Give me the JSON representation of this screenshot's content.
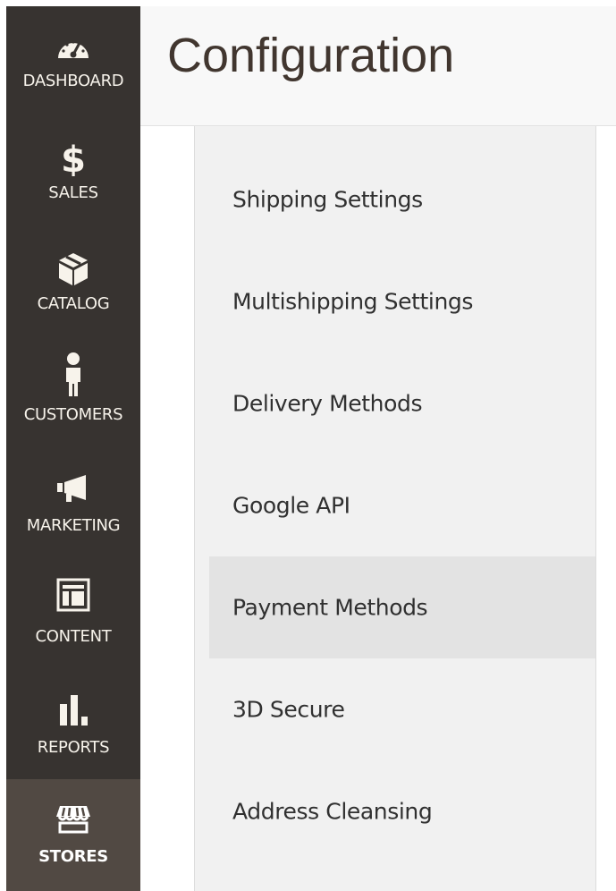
{
  "page": {
    "title": "Configuration"
  },
  "sidebar": {
    "items": [
      {
        "label": "DASHBOARD",
        "icon": "dashboard-gauge-icon"
      },
      {
        "label": "SALES",
        "icon": "dollar-icon"
      },
      {
        "label": "CATALOG",
        "icon": "box-icon"
      },
      {
        "label": "CUSTOMERS",
        "icon": "person-icon"
      },
      {
        "label": "MARKETING",
        "icon": "megaphone-icon"
      },
      {
        "label": "CONTENT",
        "icon": "layout-icon"
      },
      {
        "label": "REPORTS",
        "icon": "bar-chart-icon"
      },
      {
        "label": "STORES",
        "icon": "storefront-icon",
        "active": true
      }
    ]
  },
  "config_menu": {
    "items": [
      {
        "label": "Shipping Settings"
      },
      {
        "label": "Multishipping Settings"
      },
      {
        "label": "Delivery Methods"
      },
      {
        "label": "Google API"
      },
      {
        "label": "Payment Methods",
        "selected": true
      },
      {
        "label": "3D Secure"
      },
      {
        "label": "Address Cleansing"
      }
    ]
  },
  "colors": {
    "sidebar_bg": "#373330",
    "sidebar_active_bg": "#514943",
    "header_bg": "#f8f8f8",
    "panel_bg": "#f1f1f1",
    "selected_item_bg": "#e3e3e3",
    "text_dark": "#303030"
  }
}
